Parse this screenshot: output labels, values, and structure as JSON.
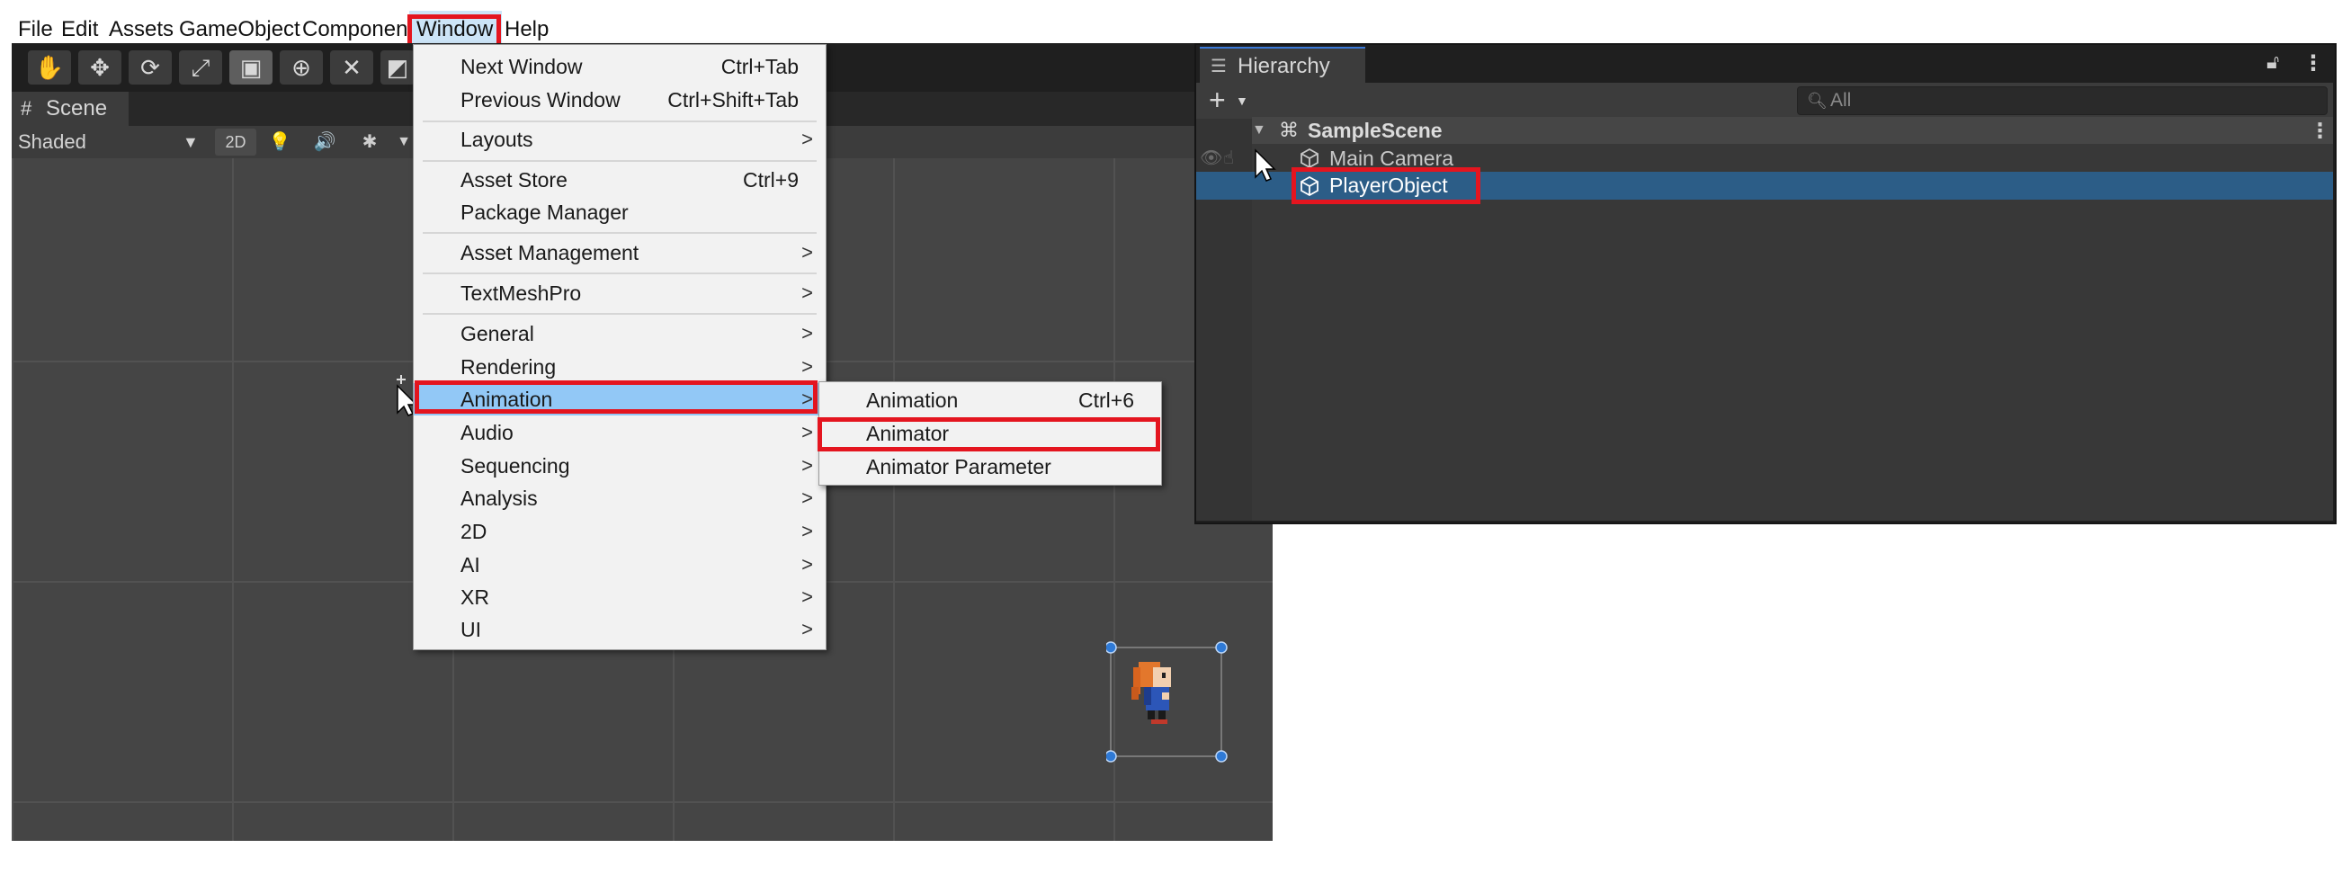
{
  "menubar": {
    "items": [
      "File",
      "Edit",
      "Assets",
      "GameObject",
      "Component",
      "Window",
      "Help"
    ],
    "active": "Window"
  },
  "scene": {
    "tab_label": "Scene",
    "shading_mode": "Shaded",
    "mode_2d": "2D"
  },
  "window_menu": {
    "items": [
      {
        "label": "Next Window",
        "shortcut": "Ctrl+Tab"
      },
      {
        "label": "Previous Window",
        "shortcut": "Ctrl+Shift+Tab"
      },
      {
        "label": "Layouts"
      },
      {
        "label": "Asset Store",
        "shortcut": "Ctrl+9"
      },
      {
        "label": "Package Manager"
      },
      {
        "label": "Asset Management"
      },
      {
        "label": "TextMeshPro"
      },
      {
        "label": "General"
      },
      {
        "label": "Rendering"
      },
      {
        "label": "Animation",
        "highlighted": true
      },
      {
        "label": "Audio"
      },
      {
        "label": "Sequencing"
      },
      {
        "label": "Analysis"
      },
      {
        "label": "2D"
      },
      {
        "label": "AI"
      },
      {
        "label": "XR"
      },
      {
        "label": "UI"
      }
    ],
    "arrow_glyph": ">"
  },
  "animation_submenu": {
    "items": [
      {
        "label": "Animation",
        "shortcut": "Ctrl+6"
      },
      {
        "label": "Animator"
      },
      {
        "label": "Animator Parameter"
      }
    ]
  },
  "hierarchy": {
    "tab_label": "Hierarchy",
    "add_label": "+",
    "search_placeholder": "All",
    "scene_name": "SampleScene",
    "objects": [
      "Main Camera",
      "PlayerObject"
    ],
    "selected": "PlayerObject"
  },
  "colors": {
    "highlight_red": "#e4151f",
    "menu_highlight": "#92c8f6",
    "selection_blue": "#2c5d87"
  }
}
